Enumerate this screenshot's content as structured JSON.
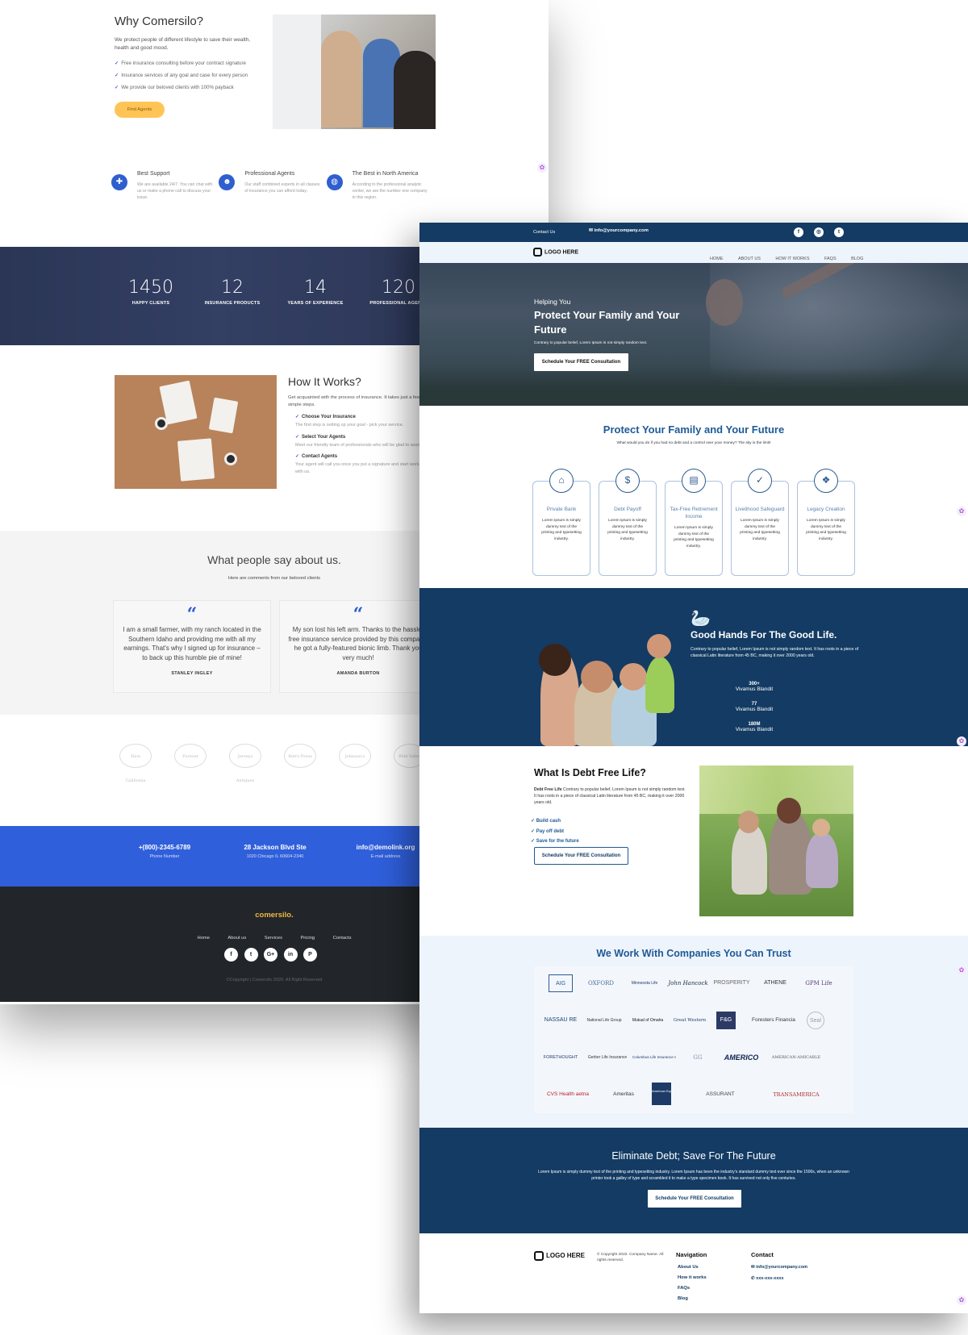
{
  "back": {
    "why": {
      "title": "Why Comersilo?",
      "intro": "We protect people of different lifestyle to save their wealth, health and good mood.",
      "checks": [
        "Free insurance consulting before your contract signature",
        "Insurance services of any goal and case for every person",
        "We provide our beloved clients with 100% payback"
      ],
      "cta": "Find Agents"
    },
    "features": [
      {
        "icon": "lifebuoy-icon",
        "title": "Best Support",
        "text": "We are available 24/7. You can chat with us or make a phone call to discuss your issue."
      },
      {
        "icon": "users-icon",
        "title": "Professional Agents",
        "text": "Our staff combined experts in all classes of insurance you can afford today."
      },
      {
        "icon": "globe-icon",
        "title": "The Best in North America",
        "text": "According to the professional analytic center, we are the number one company in this region."
      }
    ],
    "stats": [
      {
        "value": "1450",
        "label": "HAPPY CLIENTS"
      },
      {
        "value": "12",
        "label": "INSURANCE PRODUCTS"
      },
      {
        "value": "14",
        "label": "YEARS OF EXPERIENCE"
      },
      {
        "value": "120",
        "label": "PROFESSIONAL AGENTS"
      }
    ],
    "how": {
      "title": "How It Works?",
      "intro": "Get acquainted with the process of insurance. It takes just a few simple steps.",
      "steps": [
        {
          "title": "Choose Your Insurance",
          "text": "The first step is setting up your goal - pick your service."
        },
        {
          "title": "Select Your Agents",
          "text": "Meet our friendly team of professionals who will be glad to assist you."
        },
        {
          "title": "Contact Agents",
          "text": "Your agent will call you once you put a signature and start working with us."
        }
      ]
    },
    "testimonials": {
      "title": "What people say about us.",
      "subtitle": "Here are comments from our beloved clients",
      "items": [
        {
          "quote": "I am a small farmer, with my ranch located in the Southern Idaho and providing me with all my earnings. That's why I signed up for insurance – to back up this humble pie of mine!",
          "name": "STANLEY INGLEY"
        },
        {
          "quote": "My son lost his left arm. Thanks to the hassle-free insurance service provided by this company, he got a fully-featured bionic limb. Thank you very much!",
          "name": "AMANDA BURTON"
        }
      ]
    },
    "partners": [
      "Nice California",
      "Forever",
      "Jerseys Antiques",
      "Retro Press",
      "Johnson's",
      "Wild Valley"
    ],
    "contact": [
      {
        "value": "+(800)-2345-6789",
        "label": "Phone Number"
      },
      {
        "value": "28 Jackson Blvd Ste",
        "label": "1020 Chicago IL 60604-2340"
      },
      {
        "value": "info@demolink.org",
        "label": "E-mail address"
      }
    ],
    "footer": {
      "brand": "comersilo.",
      "nav": [
        "Home",
        "About us",
        "Services",
        "Pricing",
        "Contacts"
      ],
      "social": [
        "f",
        "t",
        "G+",
        "in",
        "P"
      ],
      "copyright": "©Copyright | Comersilo 2020. All Right Reserved"
    }
  },
  "front": {
    "topbar": {
      "contact": "Contact Us",
      "email": "info@yourcompany.com",
      "social": [
        "f",
        "◎",
        "t"
      ]
    },
    "nav": {
      "logo": "LOGO HERE",
      "links": [
        "HOME",
        "ABOUT US",
        "HOW IT WORKS",
        "FAQS",
        "BLOG"
      ]
    },
    "hero": {
      "pre": "Helping You",
      "title": "Protect Your Family and Your Future",
      "sub": "Contrary to popular belief, Lorem Ipsum is not simply random text.",
      "cta": "Schedule Your FREE Consultation"
    },
    "protect": {
      "title": "Protect Your Family and Your Future",
      "subtitle": "What would you do if you had no debt and a control over your money? The sky is the limit!",
      "services": [
        {
          "icon": "bank-icon",
          "title": "Private Bank",
          "text": "Lorem Ipsum is simply dummy text of the printing and typesetting industry."
        },
        {
          "icon": "dollar-hand-icon",
          "title": "Debt Payoff",
          "text": "Lorem Ipsum is simply dummy text of the printing and typesetting industry."
        },
        {
          "icon": "document-dollar-icon",
          "title": "Tax-Free Retirement Income",
          "text": "Lorem Ipsum is simply dummy text of the printing and typesetting industry."
        },
        {
          "icon": "shield-check-icon",
          "title": "Livelihood Safeguard",
          "text": "Lorem Ipsum is simply dummy text of the printing and typesetting industry."
        },
        {
          "icon": "legacy-icon",
          "title": "Legacy Creation",
          "text": "Lorem Ipsum is simply dummy text of the printing and typesetting industry."
        }
      ]
    },
    "good": {
      "title": "Good Hands For The Good Life.",
      "text": "Contrary to popular belief, Lorem Ipsum is not simply random text. It has roots in a piece of classical Latin literature from 45 BC, making it over 2000 years old.",
      "stats": [
        {
          "value": "300+",
          "label": "Vivamus Blandit"
        },
        {
          "value": "77",
          "label": "Vivamus Blandit"
        },
        {
          "value": "180M",
          "label": "Vivamus Blandit"
        }
      ]
    },
    "debt": {
      "title": "What Is Debt Free Life?",
      "lead": "Debt Free Life",
      "text": " Contrary to popular belief, Lorem Ipsum is not simply random text. It has roots in a piece of classical Latin literature from 45 BC, making it over 2000 years old.",
      "bullets": [
        "✓  Build cash",
        "✓  Pay off debt",
        "✓  Save for the future"
      ],
      "cta": "Schedule Your FREE Consultation"
    },
    "trust": {
      "title": "We Work With Companies You Can Trust",
      "companies": [
        [
          "AIG",
          "OXFORD",
          "Minnesota Life",
          "John Hancock",
          "PROSPERITY",
          "ATHENE",
          "GPM Life"
        ],
        [
          "NASSAU RE",
          "National Life Group",
          "Mutual of Omaha",
          "Great Western",
          "F&G",
          "Foresters Financial",
          "Seal"
        ],
        [
          "FORETHOUGHT",
          "Gerber Life Insurance",
          "Columbus Life Insurance Company",
          "GG",
          "AMERICO",
          "AMERICAN-AMICABLE"
        ],
        [
          "CVS Health aetna",
          "Ameritas",
          "American Equity",
          "ASSURANT",
          "TRANSAMERICA"
        ]
      ]
    },
    "eliminate": {
      "title": "Eliminate Debt; Save For The Future",
      "text": "Lorem Ipsum is simply dummy text of the printing and typesetting industry. Lorem Ipsum has been the industry's standard dummy text ever since the 1500s, when an unknown printer took a galley of type and scrambled it to make a type specimen book. It has survived not only five centuries.",
      "cta": "Schedule Your FREE Consultation"
    },
    "footer": {
      "logo": "LOGO HERE",
      "copyright": "© Copyright 2022. Company Name. All rights reserved.",
      "nav_title": "Navigation",
      "nav": [
        "About Us",
        "How it works",
        "FAQs",
        "Blog"
      ],
      "contact_title": "Contact",
      "email": "✉ info@yourcompany.com",
      "phone": "✆ xxx-xxx-xxxx"
    }
  },
  "colors": {
    "navy": "#133b63",
    "blue": "#2f5fdb",
    "accent": "#f0b743"
  }
}
